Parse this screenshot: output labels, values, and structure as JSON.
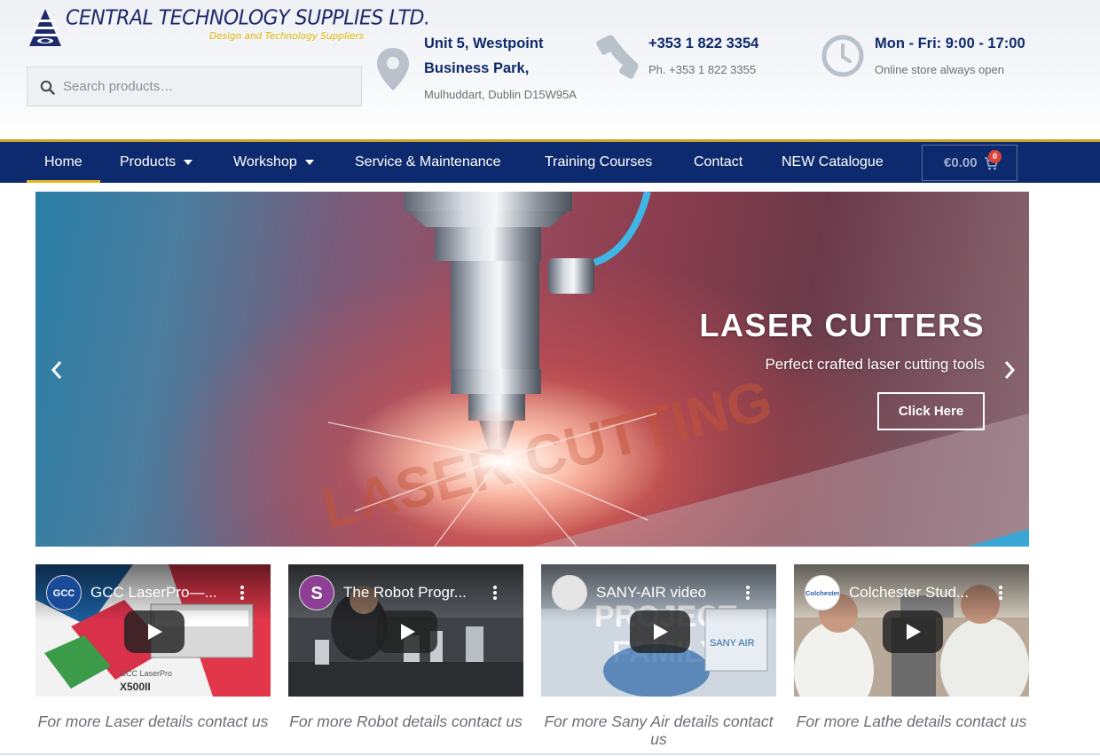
{
  "brand": {
    "name": "CENTRAL TECHNOLOGY SUPPLIES LTD.",
    "tagline": "Design and Technology Suppliers",
    "color_primary": "#0e2a6e",
    "color_accent": "#e6b91e"
  },
  "search": {
    "placeholder": "Search products…",
    "icon": "search-icon"
  },
  "contact": {
    "address": {
      "icon": "map-pin-icon",
      "line1": "Unit 5, Westpoint",
      "line2": "Business Park,",
      "line3": "Mulhuddart, Dublin D15W95A"
    },
    "phone": {
      "icon": "phone-icon",
      "line1": "+353 1 822 3354",
      "line2": "Ph. +353 1 822 3355"
    },
    "hours": {
      "icon": "clock-icon",
      "line1": "Mon - Fri: 9:00 - 17:00",
      "line2": "Online store always open"
    }
  },
  "nav": {
    "items": [
      {
        "label": "Home",
        "active": true,
        "dropdown": false
      },
      {
        "label": "Products",
        "active": false,
        "dropdown": true
      },
      {
        "label": "Workshop",
        "active": false,
        "dropdown": true
      },
      {
        "label": "Service & Maintenance",
        "active": false,
        "dropdown": false
      },
      {
        "label": "Training Courses",
        "active": false,
        "dropdown": false
      },
      {
        "label": "Contact",
        "active": false,
        "dropdown": false
      },
      {
        "label": "NEW Catalogue",
        "active": false,
        "dropdown": false
      }
    ],
    "cart": {
      "amount": "€0.00",
      "count": "0",
      "icon": "cart-icon"
    }
  },
  "hero": {
    "title": "LASER CUTTERS",
    "subtitle": "Perfect crafted laser cutting tools",
    "button": "Click Here",
    "prev_icon": "chevron-left-icon",
    "next_icon": "chevron-right-icon"
  },
  "videos": [
    {
      "title": "GCC LaserPro—...",
      "channel": "GCC",
      "caption": "For more Laser details contact us"
    },
    {
      "title": "The Robot Progr...",
      "channel": "S",
      "caption": "For more Robot details contact us"
    },
    {
      "title": "SANY-AIR video",
      "channel": "",
      "caption": "For more Sany Air details contact us"
    },
    {
      "title": "Colchester Stud...",
      "channel": "Colchester",
      "caption": "For more Lathe details contact us"
    }
  ]
}
